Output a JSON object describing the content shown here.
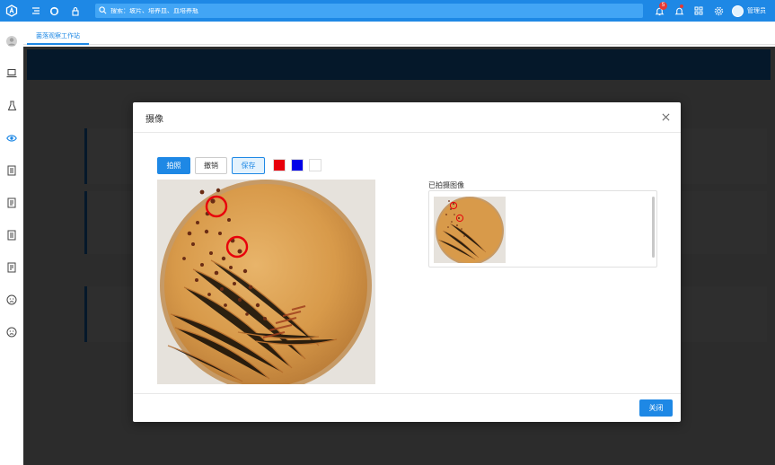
{
  "topbar": {
    "search_placeholder": "搜索：玻片、培养皿、血培养瓶",
    "notification_count": "5",
    "user_name": "管理员"
  },
  "tabs": {
    "active": "菌落观察工作站"
  },
  "modal": {
    "title": "摄像",
    "toolbar": {
      "capture_label": "拍照",
      "undo_label": "撤销",
      "save_label": "保存"
    },
    "pen_colors": [
      "#e8000b",
      "#0000e8",
      "#ffffff"
    ],
    "captured_label": "已拍摄图像",
    "close_label": "关闭"
  },
  "colors": {
    "accent": "#1e88e5",
    "annotation": "#e8000b"
  }
}
